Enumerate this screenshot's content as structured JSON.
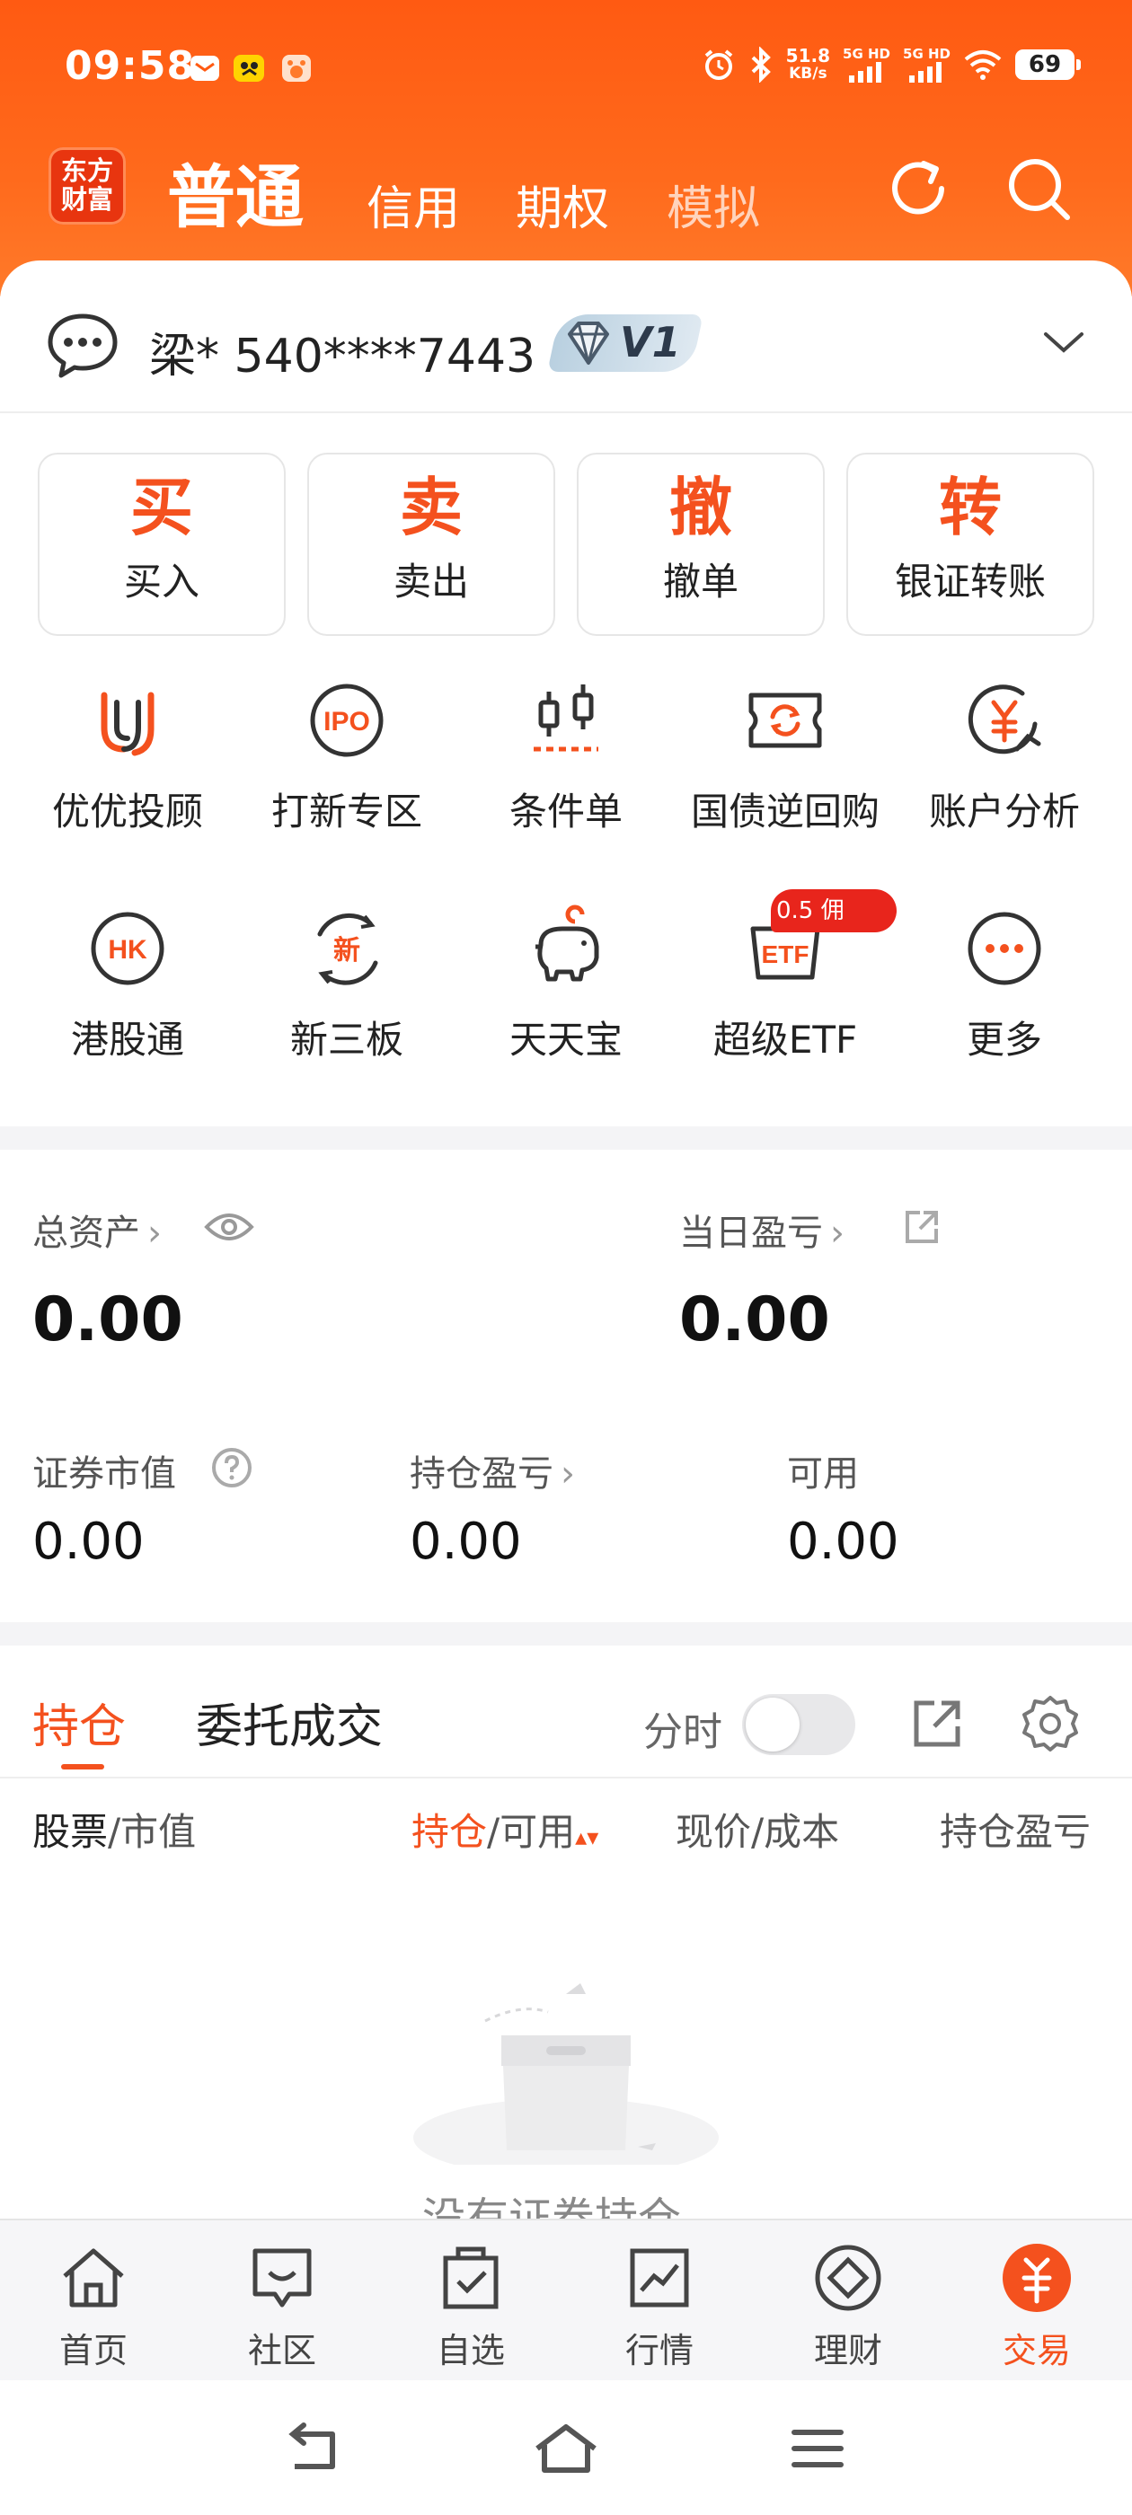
{
  "status_bar": {
    "time": "09:58",
    "net_speed_value": "51.8",
    "net_speed_unit": "KB/s",
    "sim1": "5G HD",
    "sim2": "5G HD",
    "battery": "69"
  },
  "header": {
    "logo_line1": "东方",
    "logo_line2": "财富",
    "tabs": [
      {
        "label": "普通",
        "active": true
      },
      {
        "label": "信用"
      },
      {
        "label": "期权"
      },
      {
        "label": "模拟"
      }
    ]
  },
  "account": {
    "name": "梁* 540****7443",
    "level": "V1"
  },
  "quick_actions": [
    {
      "big": "买",
      "label": "买入"
    },
    {
      "big": "卖",
      "label": "卖出"
    },
    {
      "big": "撤",
      "label": "撤单"
    },
    {
      "big": "转",
      "label": "银证转账"
    }
  ],
  "features_row1": [
    {
      "label": "优优投顾",
      "icon": "uu-advisor-icon"
    },
    {
      "label": "打新专区",
      "icon": "ipo-icon"
    },
    {
      "label": "条件单",
      "icon": "condition-order-icon"
    },
    {
      "label": "国债逆回购",
      "icon": "reverse-repo-icon"
    },
    {
      "label": "账户分析",
      "icon": "account-analysis-icon"
    }
  ],
  "features_row2": [
    {
      "label": "港股通",
      "icon": "hk-connect-icon",
      "icon_text": "HK"
    },
    {
      "label": "新三板",
      "icon": "new-third-board-icon",
      "icon_text": "新"
    },
    {
      "label": "天天宝",
      "icon": "piggy-bank-icon"
    },
    {
      "label": "超级ETF",
      "icon": "etf-icon",
      "icon_text": "ETF"
    },
    {
      "label": "更多",
      "icon": "more-icon"
    }
  ],
  "promo_badge": "0.5  佣",
  "assets": {
    "total_label": "总资产",
    "total_value": "0.00",
    "daily_pl_label": "当日盈亏",
    "daily_pl_value": "0.00",
    "market_value_label": "证券市值",
    "market_value": "0.00",
    "position_pl_label": "持仓盈亏",
    "position_pl_value": "0.00",
    "available_label": "可用",
    "available_value": "0.00"
  },
  "positions": {
    "tab_active": "持仓",
    "tab_other": "委托成交",
    "fenshi_label": "分时",
    "fenshi_on": false,
    "col_stock": "股票",
    "col_stock_sub": "/市值",
    "col_hold": "持仓",
    "col_hold_sub": "/可用",
    "col_price": "现价/成本",
    "col_pl": "持仓盈亏",
    "empty_text": "没有证券持仓"
  },
  "bottom_nav": [
    {
      "label": "首页",
      "icon": "home-icon"
    },
    {
      "label": "社区",
      "icon": "community-icon"
    },
    {
      "label": "自选",
      "icon": "watchlist-icon"
    },
    {
      "label": "行情",
      "icon": "market-icon"
    },
    {
      "label": "理财",
      "icon": "wealth-icon"
    },
    {
      "label": "交易",
      "icon": "trade-icon",
      "active": true
    }
  ],
  "colors": {
    "brand_orange": "#ff5a12",
    "accent": "#f4511e"
  }
}
